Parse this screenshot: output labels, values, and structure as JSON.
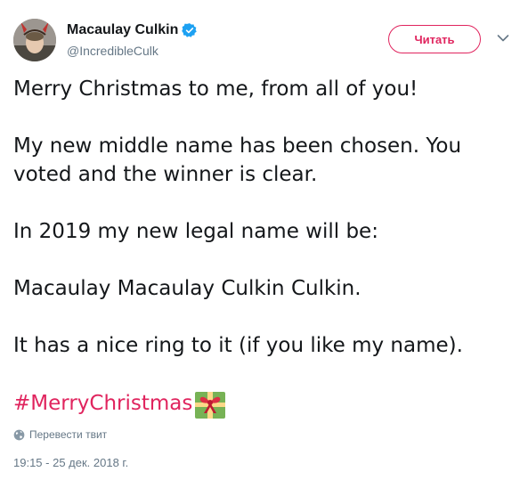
{
  "author": {
    "display_name": "Macaulay Culkin",
    "handle": "@IncredibleCulk",
    "verified": true,
    "avatar_icon": "user-avatar"
  },
  "follow_button": {
    "label": "Читать"
  },
  "menu": {
    "icon": "chevron-down-icon"
  },
  "tweet": {
    "paragraphs": [
      "Merry Christmas to me, from all of you!",
      "My new middle name has been chosen. You voted and the winner is clear.",
      "In 2019 my new legal name will be:",
      "Macaulay Macaulay Culkin Culkin.",
      "It has a nice ring to it (if you like my name)."
    ],
    "paragraph_lines": [
      [
        "Merry Christmas to me, from all of you!"
      ],
      [
        "My new middle name has been chosen. You",
        "voted and the winner is clear."
      ],
      [
        "In 2019 my new legal name will be:"
      ],
      [
        "Macaulay Macaulay Culkin Culkin."
      ],
      [
        "It has a nice ring to it (if you like my name)."
      ]
    ],
    "hashtag": "#MerryChristmas",
    "emoji_icon": "gift-icon"
  },
  "translate": {
    "label": "Перевести твит",
    "icon": "globe-icon"
  },
  "timestamp": "19:15 - 25 дек. 2018 г.",
  "colors": {
    "accent": "#e0245e",
    "verified": "#1da1f2",
    "secondary_text": "#657786",
    "primary_text": "#14171a",
    "gift_green": "#77b255",
    "gift_ribbon": "#dd2e44"
  }
}
